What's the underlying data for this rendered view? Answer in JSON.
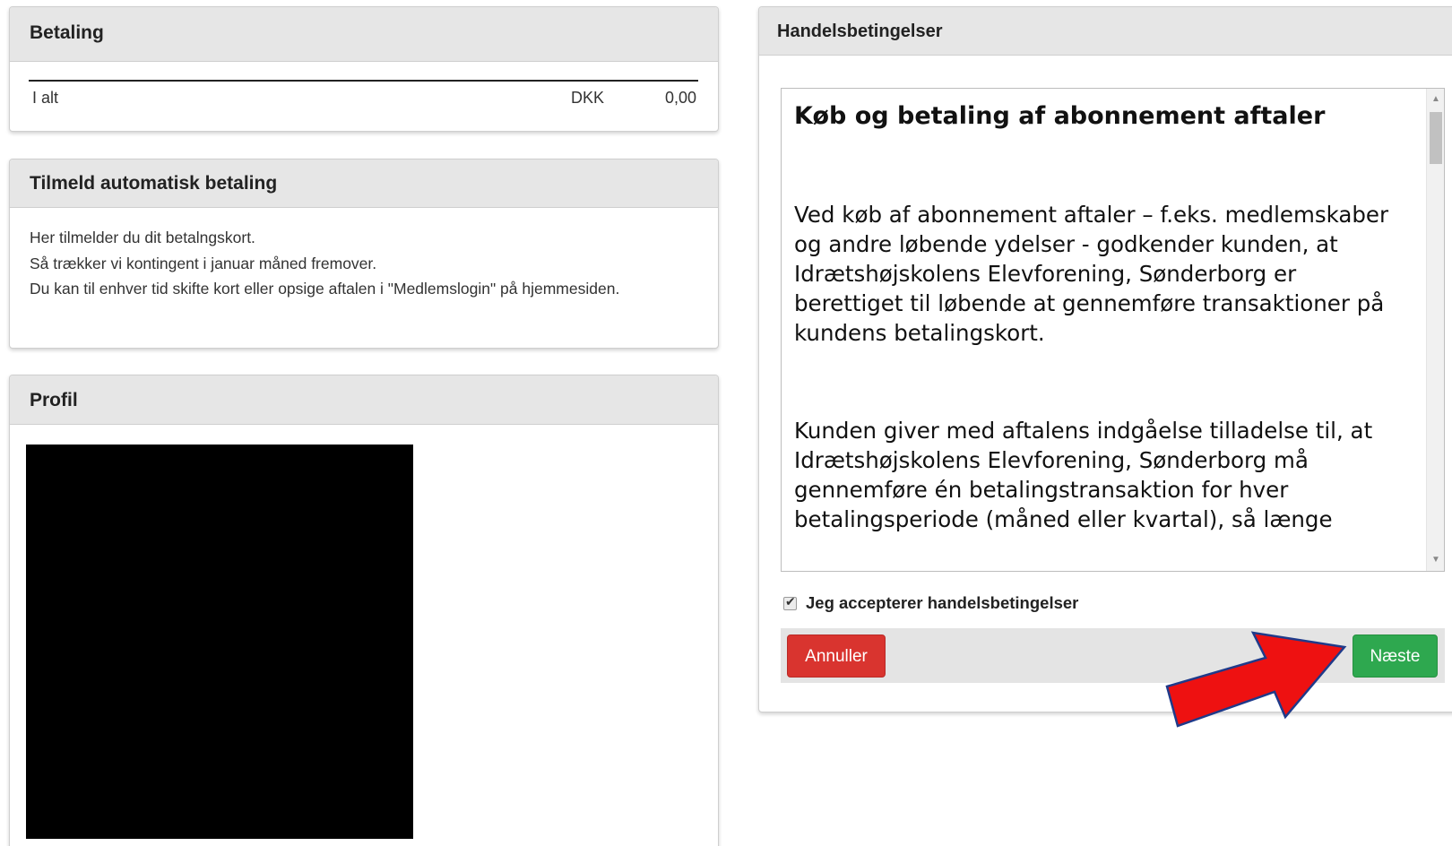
{
  "payment": {
    "title": "Betaling",
    "total_label": "I alt",
    "currency": "DKK",
    "amount": "0,00"
  },
  "auto_payment": {
    "title": "Tilmeld automatisk betaling",
    "lines": [
      "Her tilmelder du dit betalngskort.",
      "Så trækker vi kontingent i januar måned fremover.",
      "Du kan til enhver tid skifte kort eller opsige aftalen i \"Medlemslogin\" på hjemmesiden."
    ]
  },
  "profile": {
    "title": "Profil"
  },
  "terms": {
    "title": "Handelsbetingelser",
    "heading": "Køb og betaling af abonnement aftaler",
    "paragraphs": [
      "Ved køb af abonnement aftaler – f.eks. medlemskaber og andre løbende ydelser - godkender kunden, at Idrætshøjskolens Elevforening, Sønderborg er berettiget til løbende at gennemføre transaktioner på kundens betalingskort.",
      "Kunden giver med aftalens indgåelse tilladelse til, at Idrætshøjskolens Elevforening, Sønderborg må gennemføre én betalingstransaktion for hver betalingsperiode (måned eller kvartal), så længe"
    ],
    "accept_label": "Jeg accepterer handelsbetingelser",
    "accept_checked": true,
    "cancel_label": "Annuller",
    "next_label": "Næste"
  },
  "colors": {
    "cancel": "#d9342f",
    "next": "#2ea84f",
    "arrow": "#ee1111"
  }
}
